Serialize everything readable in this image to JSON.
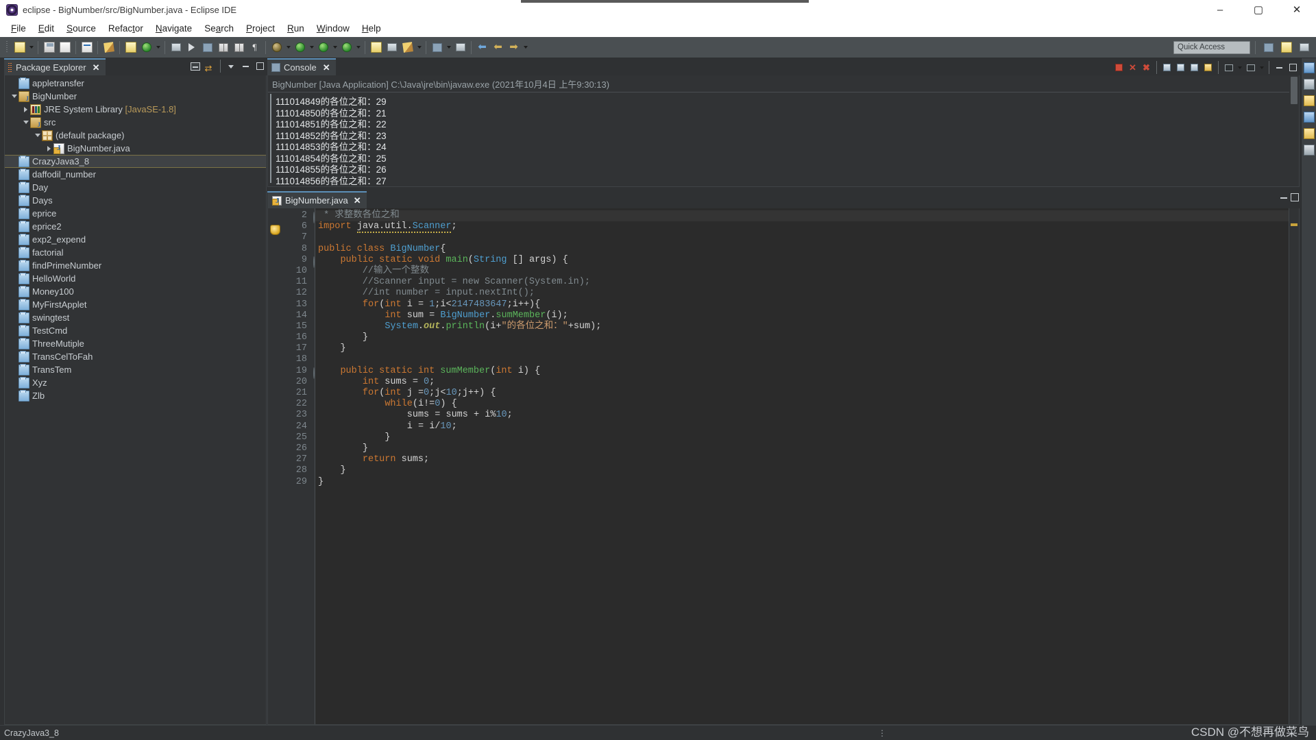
{
  "window": {
    "title": "eclipse - BigNumber/src/BigNumber.java - Eclipse IDE",
    "app_icon": "eclipse-icon",
    "minimize": "–",
    "maximize": "▢",
    "close": "✕"
  },
  "menu": {
    "items": [
      {
        "label": "File",
        "mnemonic": "F"
      },
      {
        "label": "Edit",
        "mnemonic": "E"
      },
      {
        "label": "Source",
        "mnemonic": "S"
      },
      {
        "label": "Refactor",
        "mnemonic": "t"
      },
      {
        "label": "Navigate",
        "mnemonic": "N"
      },
      {
        "label": "Search",
        "mnemonic": "a"
      },
      {
        "label": "Project",
        "mnemonic": "P"
      },
      {
        "label": "Run",
        "mnemonic": "R"
      },
      {
        "label": "Window",
        "mnemonic": "W"
      },
      {
        "label": "Help",
        "mnemonic": "H"
      }
    ]
  },
  "toolbar": {
    "quick_access_placeholder": "Quick Access",
    "buttons": [
      "new-wizard-icon",
      "save-icon",
      "save-all-icon",
      "print-icon",
      "toggle-breadcrumb-icon",
      "new-java-project-icon",
      "new-java-class-icon",
      "search-icon",
      "java-perspective-icon",
      "open-type-icon",
      "open-task-icon",
      "pilcrow-icon",
      "external-tools-icon",
      "run-icon",
      "debug-icon",
      "coverage-icon",
      "skip-breakpoints-icon",
      "next-annotation-icon",
      "previous-annotation-icon",
      "back-icon",
      "forward-icon"
    ],
    "right_buttons": [
      "open-perspective-icon",
      "java-perspective-icon",
      "java-ee-perspective-icon"
    ]
  },
  "explorer": {
    "tab_label": "Package Explorer",
    "close_label": "✕",
    "tools": [
      "collapse-all-icon",
      "link-with-editor-icon",
      "view-menu-icon",
      "minimize-icon",
      "maximize-icon"
    ],
    "tree": [
      {
        "label": "appletransfer",
        "icon": "folder-icon",
        "indent": 1,
        "twisty": "none",
        "selected": false
      },
      {
        "label": "BigNumber",
        "icon": "java-project-icon",
        "indent": 1,
        "twisty": "open",
        "selected": false
      },
      {
        "label": "JRE System Library",
        "sub": "[JavaSE-1.8]",
        "icon": "library-icon",
        "indent": 2,
        "twisty": "closed",
        "selected": false
      },
      {
        "label": "src",
        "icon": "source-folder-icon",
        "indent": 2,
        "twisty": "open",
        "selected": false
      },
      {
        "label": "(default package)",
        "icon": "package-icon",
        "indent": 3,
        "twisty": "open",
        "selected": false
      },
      {
        "label": "BigNumber.java",
        "icon": "java-file-icon",
        "indent": 4,
        "twisty": "closed",
        "selected": false
      },
      {
        "label": "CrazyJava3_8",
        "icon": "folder-icon",
        "indent": 1,
        "twisty": "none",
        "selected": true
      },
      {
        "label": "daffodil_number",
        "icon": "folder-icon",
        "indent": 1,
        "twisty": "none",
        "selected": false
      },
      {
        "label": "Day",
        "icon": "folder-icon",
        "indent": 1,
        "twisty": "none",
        "selected": false
      },
      {
        "label": "Days",
        "icon": "folder-icon",
        "indent": 1,
        "twisty": "none",
        "selected": false
      },
      {
        "label": "eprice",
        "icon": "folder-icon",
        "indent": 1,
        "twisty": "none",
        "selected": false
      },
      {
        "label": "eprice2",
        "icon": "folder-icon",
        "indent": 1,
        "twisty": "none",
        "selected": false
      },
      {
        "label": "exp2_expend",
        "icon": "folder-icon",
        "indent": 1,
        "twisty": "none",
        "selected": false
      },
      {
        "label": "factorial",
        "icon": "folder-icon",
        "indent": 1,
        "twisty": "none",
        "selected": false
      },
      {
        "label": "findPrimeNumber",
        "icon": "folder-icon",
        "indent": 1,
        "twisty": "none",
        "selected": false
      },
      {
        "label": "HelloWorld",
        "icon": "folder-icon",
        "indent": 1,
        "twisty": "none",
        "selected": false
      },
      {
        "label": "Money100",
        "icon": "folder-icon",
        "indent": 1,
        "twisty": "none",
        "selected": false
      },
      {
        "label": "MyFirstApplet",
        "icon": "folder-icon",
        "indent": 1,
        "twisty": "none",
        "selected": false
      },
      {
        "label": "swingtest",
        "icon": "folder-icon",
        "indent": 1,
        "twisty": "none",
        "selected": false
      },
      {
        "label": "TestCmd",
        "icon": "folder-icon",
        "indent": 1,
        "twisty": "none",
        "selected": false
      },
      {
        "label": "ThreeMutiple",
        "icon": "folder-icon",
        "indent": 1,
        "twisty": "none",
        "selected": false
      },
      {
        "label": "TransCelToFah",
        "icon": "folder-icon",
        "indent": 1,
        "twisty": "none",
        "selected": false
      },
      {
        "label": "TransTem",
        "icon": "folder-icon",
        "indent": 1,
        "twisty": "none",
        "selected": false
      },
      {
        "label": "Xyz",
        "icon": "folder-icon",
        "indent": 1,
        "twisty": "none",
        "selected": false
      },
      {
        "label": "Zlb",
        "icon": "folder-icon",
        "indent": 1,
        "twisty": "none",
        "selected": false
      }
    ]
  },
  "console": {
    "tab_label": "Console",
    "close_label": "✕",
    "launch_line": "BigNumber [Java Application] C:\\Java\\jre\\bin\\javaw.exe (2021年10月4日 上午9:30:13)",
    "lines": [
      "111014849的各位之和：29",
      "111014850的各位之和：21",
      "111014851的各位之和：22",
      "111014852的各位之和：23",
      "111014853的各位之和：24",
      "111014854的各位之和：25",
      "111014855的各位之和：26",
      "111014856的各位之和：27"
    ],
    "tools": [
      "terminate-icon",
      "remove-launch-icon",
      "remove-all-terminated-icon",
      "clear-console-icon",
      "scroll-lock-icon",
      "word-wrap-icon",
      "pin-console-icon",
      "display-selected-console-icon",
      "open-console-icon",
      "view-menu-icon",
      "minimize-icon",
      "maximize-icon"
    ]
  },
  "editor": {
    "tab_label": "BigNumber.java",
    "close_label": "✕",
    "minimize": "minimize-icon",
    "maximize": "maximize-icon",
    "lines": [
      {
        "n": "2",
        "fold": "plus",
        "first": true
      },
      {
        "n": "6",
        "fold": "",
        "marker": "warning"
      },
      {
        "n": "7",
        "fold": ""
      },
      {
        "n": "8",
        "fold": ""
      },
      {
        "n": "9",
        "fold": "minus"
      },
      {
        "n": "10",
        "fold": ""
      },
      {
        "n": "11",
        "fold": ""
      },
      {
        "n": "12",
        "fold": ""
      },
      {
        "n": "13",
        "fold": ""
      },
      {
        "n": "14",
        "fold": ""
      },
      {
        "n": "15",
        "fold": ""
      },
      {
        "n": "16",
        "fold": ""
      },
      {
        "n": "17",
        "fold": ""
      },
      {
        "n": "18",
        "fold": ""
      },
      {
        "n": "19",
        "fold": "minus"
      },
      {
        "n": "20",
        "fold": ""
      },
      {
        "n": "21",
        "fold": ""
      },
      {
        "n": "22",
        "fold": ""
      },
      {
        "n": "23",
        "fold": ""
      },
      {
        "n": "24",
        "fold": ""
      },
      {
        "n": "25",
        "fold": ""
      },
      {
        "n": "26",
        "fold": ""
      },
      {
        "n": "27",
        "fold": ""
      },
      {
        "n": "28",
        "fold": ""
      },
      {
        "n": "29",
        "fold": ""
      }
    ],
    "code_text": [
      " * 求整数各位之和",
      "import java.util.Scanner;",
      "",
      "public class BigNumber{",
      "    public static void main(String [] args) {",
      "        //输入一个整数",
      "        //Scanner input = new Scanner(System.in);",
      "        //int number = input.nextInt();",
      "        for(int i = 1;i<2147483647;i++){",
      "            int sum = BigNumber.sumMember(i);",
      "            System.out.println(i+\"的各位之和：\"+sum);",
      "        }",
      "    }",
      "",
      "    public static int sumMember(int i) {",
      "        int sums = 0;",
      "        for(int j =0;j<10;j++) {",
      "            while(i!=0) {",
      "                sums = sums + i%10;",
      "                i = i/10;",
      "            }",
      "        }",
      "        return sums;",
      "    }",
      "}"
    ]
  },
  "statusbar": {
    "text": "CrazyJava3_8",
    "dots": "⋮"
  },
  "watermark": "CSDN @不想再做菜鸟"
}
